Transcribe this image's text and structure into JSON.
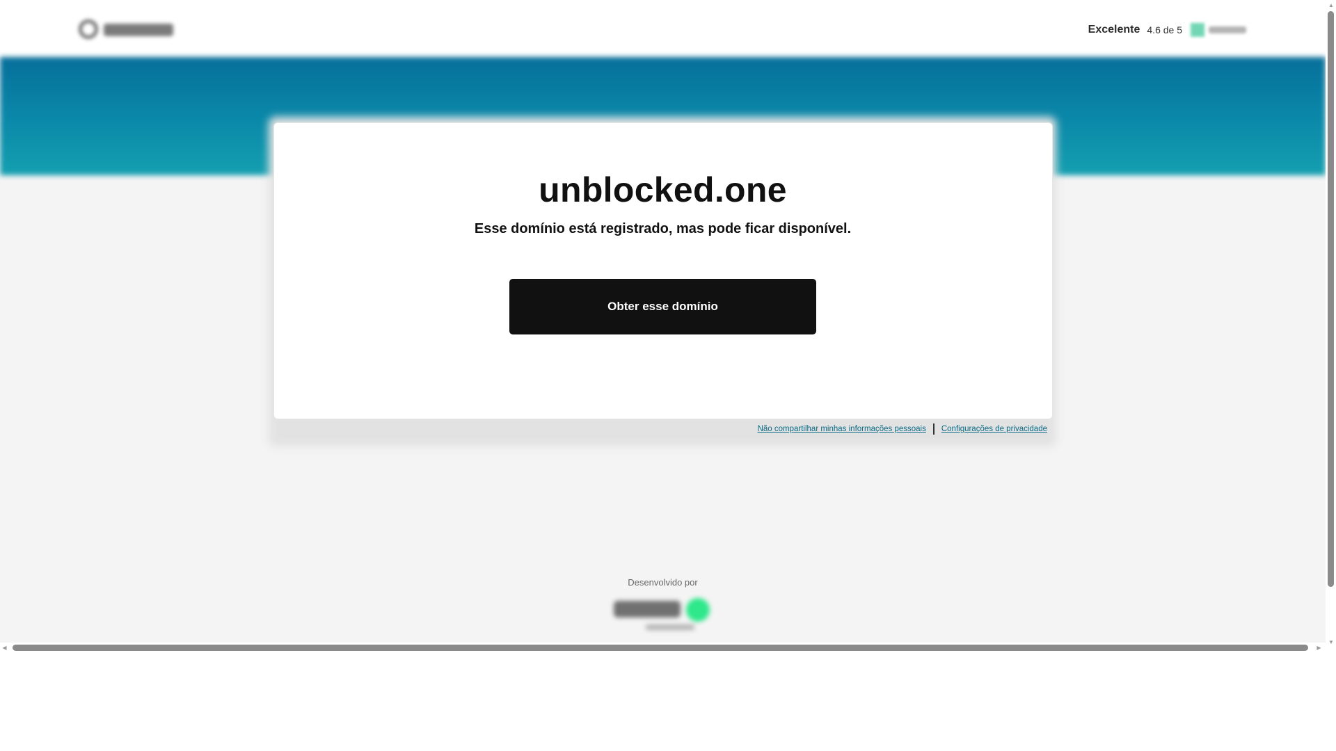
{
  "header": {
    "logo_icon": "godaddy-logo-icon",
    "rating_label": "Excelente",
    "rating_score": "4.6 de 5",
    "trustpilot_icon": "trustpilot-star-icon"
  },
  "colors": {
    "hero_top": "#066f9a",
    "hero_bottom": "#149fb0",
    "cta_bg": "#111111",
    "link": "#0a6b86",
    "page_bg": "#f4f4f4",
    "brand_green": "#2ee88b"
  },
  "main": {
    "domain": "unblocked.one",
    "subtitle": "Esse domínio está registrado, mas pode ficar disponível.",
    "cta_label": "Obter esse domínio"
  },
  "privacy": {
    "do_not_share": "Não compartilhar minhas informações pessoais",
    "settings": "Configurações de privacidade"
  },
  "footer": {
    "powered_by": "Desenvolvido por",
    "powered_logo_icon": "afternic-logo-icon"
  }
}
